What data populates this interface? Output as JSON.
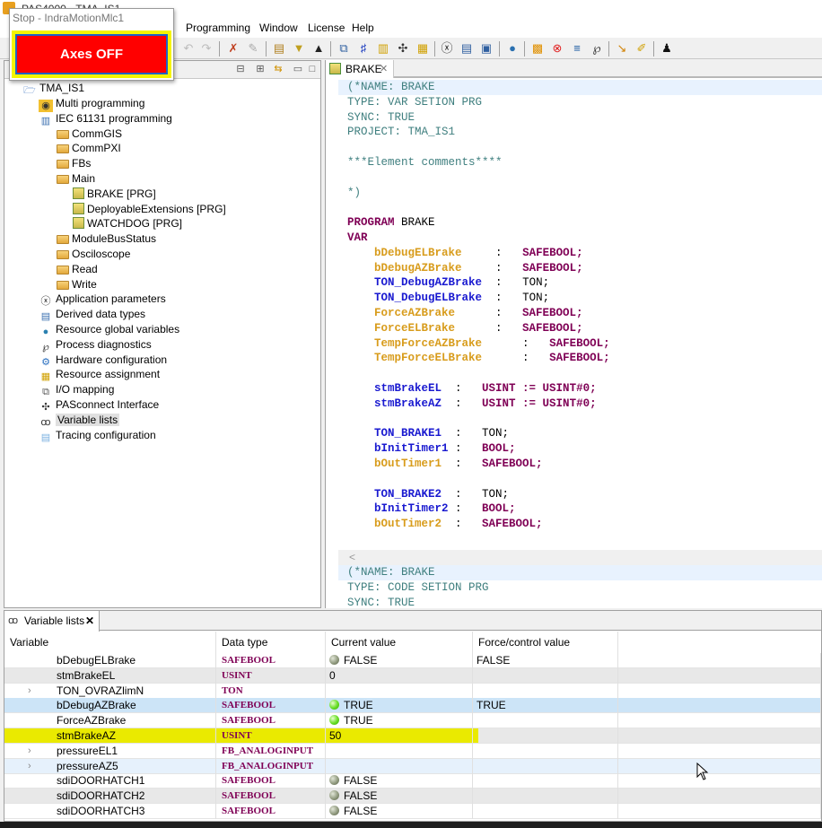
{
  "window": {
    "title": "PAS4000 - TMA_IS1"
  },
  "menu": {
    "items": [
      "Programming",
      "Window",
      "License",
      "Help"
    ]
  },
  "popup": {
    "title": "Stop - IndraMotionMlc1",
    "button_label": "Axes OFF",
    "button_color": "#ff0000",
    "frame_color": "#f5f500"
  },
  "tree": {
    "root": "TMA_IS1",
    "items": [
      {
        "label": "Multi programming",
        "icon": "multi-programming-icon",
        "level": 1
      },
      {
        "label": "IEC 61131 programming",
        "icon": "iec-programming-icon",
        "level": 1
      },
      {
        "label": "CommGIS",
        "icon": "folder-icon",
        "level": 2
      },
      {
        "label": "CommPXI",
        "icon": "folder-icon",
        "level": 2
      },
      {
        "label": "FBs",
        "icon": "folder-icon",
        "level": 2
      },
      {
        "label": "Main",
        "icon": "folder-icon",
        "level": 2
      },
      {
        "label": "BRAKE [PRG]",
        "icon": "program-icon",
        "level": 3
      },
      {
        "label": "DeployableExtensions [PRG]",
        "icon": "program-icon",
        "level": 3
      },
      {
        "label": "WATCHDOG [PRG]",
        "icon": "program-icon",
        "level": 3
      },
      {
        "label": "ModuleBusStatus",
        "icon": "folder-icon",
        "level": 2
      },
      {
        "label": "Osciloscope",
        "icon": "folder-icon",
        "level": 2
      },
      {
        "label": "Read",
        "icon": "folder-icon",
        "level": 2
      },
      {
        "label": "Write",
        "icon": "folder-icon",
        "level": 2
      },
      {
        "label": "Application parameters",
        "icon": "application-parameters-icon",
        "level": 1
      },
      {
        "label": "Derived data types",
        "icon": "derived-data-types-icon",
        "level": 1
      },
      {
        "label": "Resource global variables",
        "icon": "globe-icon",
        "level": 1
      },
      {
        "label": "Process diagnostics",
        "icon": "stethoscope-icon",
        "level": 1
      },
      {
        "label": "Hardware configuration",
        "icon": "hardware-configuration-icon",
        "level": 1
      },
      {
        "label": "Resource assignment",
        "icon": "resource-assignment-icon",
        "level": 1
      },
      {
        "label": "I/O mapping",
        "icon": "io-mapping-icon",
        "level": 1
      },
      {
        "label": "PASconnect Interface",
        "icon": "network-icon",
        "level": 1
      },
      {
        "label": "Variable lists",
        "icon": "glasses-icon",
        "level": 1,
        "selected": true
      },
      {
        "label": "Tracing configuration",
        "icon": "database-icon",
        "level": 1
      }
    ]
  },
  "editor": {
    "tab_label": "BRAKE",
    "header_comment": [
      "(*NAME: BRAKE",
      "TYPE: VAR SETION PRG",
      "SYNC: TRUE",
      "PROJECT: TMA_IS1",
      "",
      "***Element comments****",
      "",
      "*)"
    ],
    "program_kw": "PROGRAM",
    "program_name": "BRAKE",
    "var_kw": "VAR",
    "declarations": [
      {
        "name": "bDebugELBrake",
        "type": "SAFEBOOL;",
        "kind": "safe",
        "tkind": "ty",
        "group": 0
      },
      {
        "name": "bDebugAZBrake",
        "type": "SAFEBOOL;",
        "kind": "safe",
        "tkind": "ty",
        "group": 0
      },
      {
        "name": "TON_DebugAZBrake",
        "type": "TON;",
        "kind": "std",
        "tkind": "tn",
        "group": 0
      },
      {
        "name": "TON_DebugELBrake",
        "type": "TON;",
        "kind": "std",
        "tkind": "tn",
        "group": 0
      },
      {
        "name": "ForceAZBrake",
        "type": "SAFEBOOL;",
        "kind": "safe",
        "tkind": "ty",
        "group": 0
      },
      {
        "name": "ForceELBrake",
        "type": "SAFEBOOL;",
        "kind": "safe",
        "tkind": "ty",
        "group": 0
      },
      {
        "name": "TempForceAZBrake",
        "type": "SAFEBOOL;",
        "kind": "safe",
        "tkind": "ty",
        "group": 1
      },
      {
        "name": "TempForceELBrake",
        "type": "SAFEBOOL;",
        "kind": "safe",
        "tkind": "ty",
        "group": 1
      },
      {
        "name": "stmBrakeEL",
        "type": "USINT := USINT#0;",
        "kind": "std",
        "tkind": "ty",
        "group": 2
      },
      {
        "name": "stmBrakeAZ",
        "type": "USINT := USINT#0;",
        "kind": "std",
        "tkind": "ty",
        "group": 2
      },
      {
        "name": "TON_BRAKE1",
        "type": "TON;",
        "kind": "std",
        "tkind": "tn",
        "group": 3
      },
      {
        "name": "bInitTimer1",
        "type": "BOOL;",
        "kind": "std",
        "tkind": "ty",
        "group": 3
      },
      {
        "name": "bOutTimer1",
        "type": "SAFEBOOL;",
        "kind": "safe",
        "tkind": "ty",
        "group": 3
      },
      {
        "name": "TON_BRAKE2",
        "type": "TON;",
        "kind": "std",
        "tkind": "tn",
        "group": 3
      },
      {
        "name": "bInitTimer2",
        "type": "BOOL;",
        "kind": "std",
        "tkind": "ty",
        "group": 3
      },
      {
        "name": "bOutTimer2",
        "type": "SAFEBOOL;",
        "kind": "safe",
        "tkind": "ty",
        "group": 3
      }
    ],
    "code_comment": [
      "(*NAME: BRAKE",
      "TYPE: CODE SETION PRG",
      "SYNC: TRUE"
    ],
    "scroll_left_glyph": "<"
  },
  "variable_lists": {
    "tab_label": "Variable lists",
    "columns": [
      "Variable",
      "Data type",
      "Current value",
      "Force/control value"
    ],
    "rows": [
      {
        "variable": "bDebugELBrake",
        "type": "SAFEBOOL",
        "current": "FALSE",
        "led": "off",
        "force": "FALSE",
        "expandable": false,
        "style": ""
      },
      {
        "variable": "stmBrakeEL",
        "type": "USINT",
        "current": "0",
        "led": "",
        "force": "",
        "expandable": false,
        "style": "alt"
      },
      {
        "variable": "TON_OVRAZlimN",
        "type": "TON",
        "current": "",
        "led": "",
        "force": "",
        "expandable": true,
        "style": ""
      },
      {
        "variable": "bDebugAZBrake",
        "type": "SAFEBOOL",
        "current": "TRUE",
        "led": "on",
        "force": "TRUE",
        "expandable": false,
        "style": "sel"
      },
      {
        "variable": "ForceAZBrake",
        "type": "SAFEBOOL",
        "current": "TRUE",
        "led": "on",
        "force": "",
        "expandable": false,
        "style": ""
      },
      {
        "variable": "stmBrakeAZ",
        "type": "USINT",
        "current": "50",
        "led": "",
        "force": "",
        "expandable": false,
        "style": "alt",
        "highlighted": true
      },
      {
        "variable": "pressureEL1",
        "type": "FB_ANALOGINPUT",
        "current": "",
        "led": "",
        "force": "",
        "expandable": true,
        "style": ""
      },
      {
        "variable": "pressureAZ5",
        "type": "FB_ANALOGINPUT",
        "current": "",
        "led": "",
        "force": "",
        "expandable": true,
        "style": "hov"
      },
      {
        "variable": "sdiDOORHATCH1",
        "type": "SAFEBOOL",
        "current": "FALSE",
        "led": "off",
        "force": "",
        "expandable": false,
        "style": ""
      },
      {
        "variable": "sdiDOORHATCH2",
        "type": "SAFEBOOL",
        "current": "FALSE",
        "led": "off",
        "force": "",
        "expandable": false,
        "style": "alt"
      },
      {
        "variable": "sdiDOORHATCH3",
        "type": "SAFEBOOL",
        "current": "FALSE",
        "led": "off",
        "force": "",
        "expandable": false,
        "style": ""
      }
    ]
  }
}
